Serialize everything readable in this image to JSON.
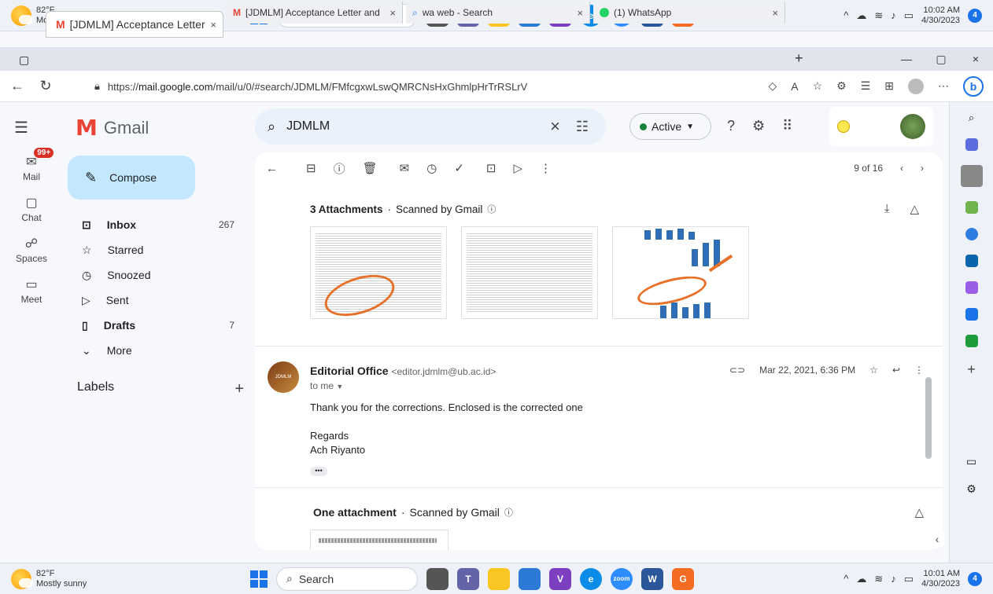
{
  "taskbar": {
    "temp": "82°F",
    "weather": "Mostly sunny",
    "search": "Search",
    "time_top": "10:02 AM",
    "time_bottom": "10:01 AM",
    "date": "4/30/2023",
    "notif_count": "4",
    "apps": [
      "explorer",
      "teams",
      "files",
      "store",
      "vs",
      "edge",
      "zoom",
      "word",
      "pdf"
    ]
  },
  "browser": {
    "tabs": [
      {
        "title": "[JDMLM] Acceptance Letter - okt"
      },
      {
        "title": "[JDMLM] Acceptance Letter and"
      },
      {
        "title": "wa web - Search"
      },
      {
        "title": "(1) WhatsApp"
      }
    ],
    "url_prefix": "https://",
    "url_host": "mail.google.com",
    "url_path": "/mail/u/0/#search/JDMLM/FMfcgxwLswQMRCNsHxGhmlpHrTrRSLrV"
  },
  "gmail": {
    "app_name": "Gmail",
    "search_value": "JDMLM",
    "status": "Active",
    "rail": [
      {
        "label": "Mail",
        "badge": "99+"
      },
      {
        "label": "Chat"
      },
      {
        "label": "Spaces"
      },
      {
        "label": "Meet"
      }
    ],
    "compose": "Compose",
    "folders": [
      {
        "label": "Inbox",
        "count": "267",
        "bold": true
      },
      {
        "label": "Starred",
        "count": ""
      },
      {
        "label": "Snoozed",
        "count": ""
      },
      {
        "label": "Sent",
        "count": ""
      },
      {
        "label": "Drafts",
        "count": "7",
        "bold": true
      },
      {
        "label": "More",
        "count": ""
      }
    ],
    "labels_heading": "Labels",
    "pager": "9 of 16",
    "attachments_1": "3 Attachments",
    "scanned": "Scanned by Gmail",
    "message": {
      "sender": "Editorial Office",
      "email": "<editor.jdmlm@ub.ac.id>",
      "to": "to me",
      "date": "Mar 22, 2021, 6:36 PM",
      "body_line1": "Thank you for the corrections. Enclosed is the corrected one",
      "body_line2": "Regards",
      "body_line3": "Ach Riyanto"
    },
    "attachments_2": "One attachment"
  }
}
